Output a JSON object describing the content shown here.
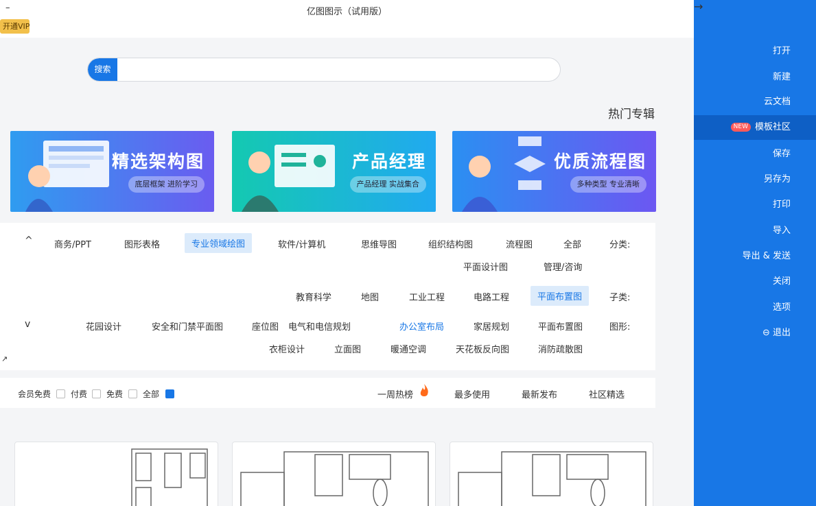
{
  "window": {
    "title": "亿图图示（试用版）",
    "minimize": "–",
    "vip_label": "开通VIP"
  },
  "search": {
    "button": "搜索",
    "placeholder": ""
  },
  "section_title": "热门专辑",
  "banners": [
    {
      "title": "精选架构图",
      "sub": "底层框架 进阶学习"
    },
    {
      "title": "产品经理",
      "sub": "产品经理 实战集合"
    },
    {
      "title": "优质流程图",
      "sub": "多种类型 专业清晰"
    }
  ],
  "filters": {
    "category_label": "分类:",
    "categories": [
      "全部",
      "流程图",
      "组织结构图",
      "思维导图",
      "软件/计算机",
      "专业领域绘图",
      "图形表格",
      "商务/PPT",
      "管理/咨询",
      "平面设计图"
    ],
    "sub_label": "子类:",
    "subcategories": [
      "平面布置图",
      "电路工程",
      "工业工程",
      "地图",
      "教育科学"
    ],
    "shape_label": "图形:",
    "shapes": [
      "平面布置图",
      "家居规划",
      "办公室布局",
      "电气和电信规划",
      "座位图",
      "安全和门禁平面图",
      "花园设计",
      "消防疏散图",
      "天花板反向图",
      "暖通空调",
      "立面图",
      "衣柜设计"
    ],
    "toggle_up": "^",
    "toggle_down": "v",
    "expand": "↗"
  },
  "sort": {
    "tabs": [
      "社区精选",
      "最新发布",
      "最多使用",
      "一周热榜"
    ],
    "price": [
      "全部",
      "免费",
      "付费",
      "会员免费"
    ]
  },
  "sidebar": {
    "back_icon": "→",
    "items": [
      "打开",
      "新建",
      "云文档",
      "模板社区",
      "保存",
      "另存为",
      "打印",
      "导入",
      "导出 & 发送",
      "关闭",
      "选项",
      "退出"
    ],
    "new_badge": "NEW"
  }
}
